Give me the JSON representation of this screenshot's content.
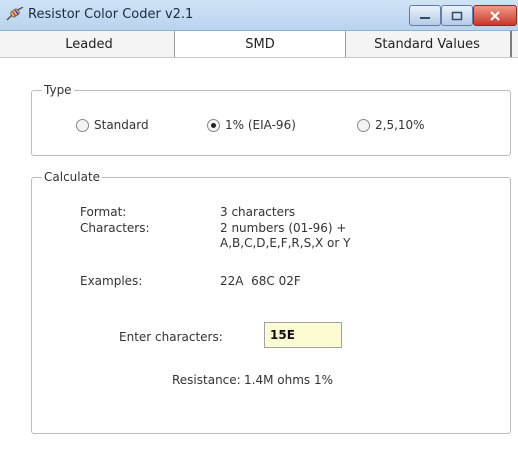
{
  "window": {
    "title": "Resistor Color Coder v2.1"
  },
  "tabs": [
    {
      "label": "Leaded"
    },
    {
      "label": "SMD"
    },
    {
      "label": "Standard Values"
    }
  ],
  "type_group": {
    "legend": "Type",
    "options": [
      {
        "label": "Standard",
        "selected": false
      },
      {
        "label": "1% (EIA-96)",
        "selected": true
      },
      {
        "label": "2,5,10%",
        "selected": false
      }
    ]
  },
  "calculate": {
    "legend": "Calculate",
    "format_label": "Format:",
    "format_value": "3 characters",
    "characters_label": "Characters:",
    "characters_value_line1": "2 numbers (01-96) +",
    "characters_value_line2": "A,B,C,D,E,F,R,S,X or Y",
    "examples_label": "Examples:",
    "examples_value": "22A  68C 02F",
    "enter_label": "Enter characters:",
    "enter_value": "15E",
    "resistance_label": "Resistance:",
    "resistance_value": "1.4M ohms 1%"
  }
}
